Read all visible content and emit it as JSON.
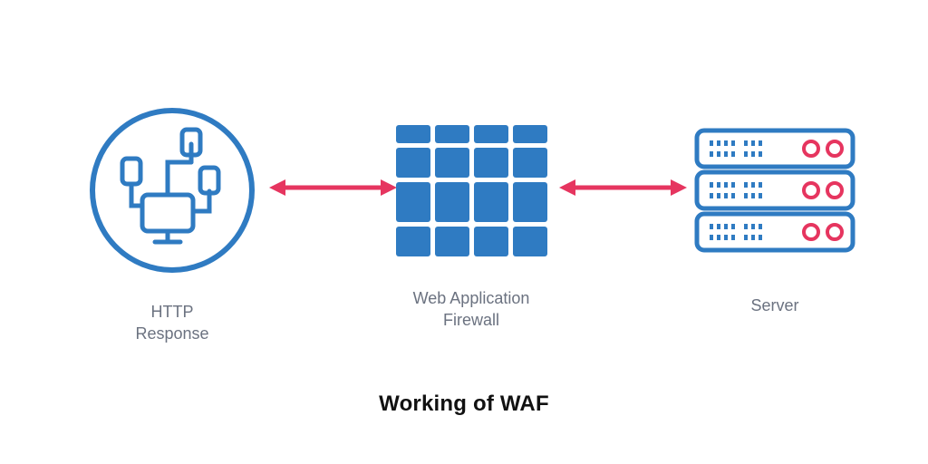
{
  "title": "Working of WAF",
  "colors": {
    "stroke_blue": "#2f7bc2",
    "fill_blue": "#2f7bc2",
    "arrow_red": "#e6355f",
    "label_gray": "#6b7280",
    "title_black": "#111111"
  },
  "nodes": {
    "client": {
      "label": "HTTP\nResponse",
      "icon": "network-circle-icon"
    },
    "waf": {
      "label": "Web Application\nFirewall",
      "icon": "firewall-grid-icon"
    },
    "server": {
      "label": "Server",
      "icon": "server-rack-icon"
    }
  },
  "arrows": [
    {
      "from": "client",
      "to": "waf",
      "bidirectional": true
    },
    {
      "from": "waf",
      "to": "server",
      "bidirectional": true
    }
  ]
}
